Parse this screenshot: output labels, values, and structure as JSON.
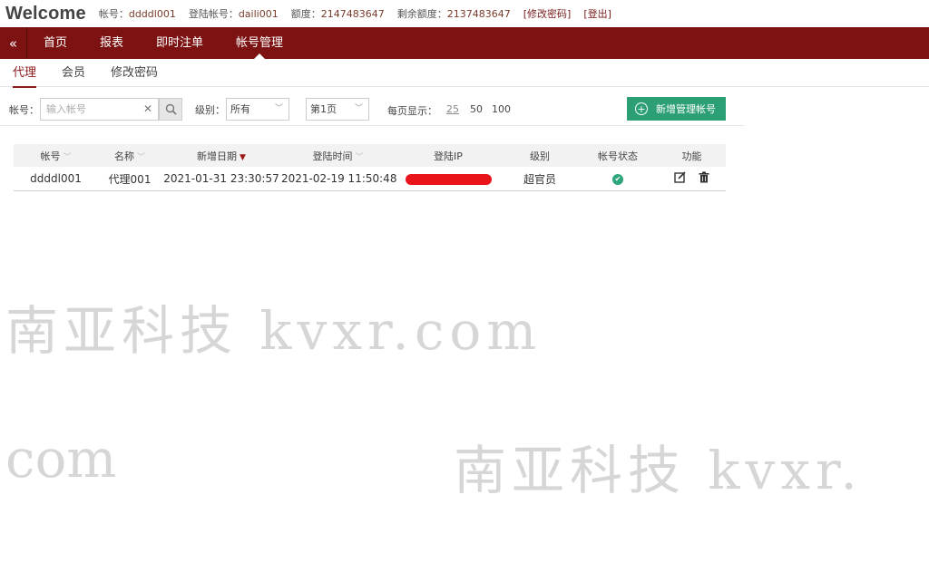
{
  "header": {
    "welcome": "Welcome",
    "account_label": "帐号：",
    "account_value": "ddddl001",
    "login_label": "登陆帐号：",
    "login_value": "daili001",
    "quota_label": "额度：",
    "quota_value": "2147483647",
    "remaining_label": "剩余额度：",
    "remaining_value": "2137483647",
    "change_password_link": "[修改密码]",
    "logout_link": "[登出]"
  },
  "nav": {
    "collapse_glyph": "«",
    "items": [
      {
        "label": "首页"
      },
      {
        "label": "报表"
      },
      {
        "label": "即时注单"
      },
      {
        "label": "帐号管理",
        "active": true
      }
    ]
  },
  "subtabs": [
    {
      "label": "代理",
      "active": true
    },
    {
      "label": "会员"
    },
    {
      "label": "修改密码"
    }
  ],
  "filters": {
    "account_label": "帐号：",
    "account_placeholder": "输入帐号",
    "clear_glyph": "✕",
    "level_label": "级别：",
    "level_value": "所有",
    "page_value": "第1页",
    "per_page_label": "每页显示：",
    "per_page_options": [
      "25",
      "50",
      "100"
    ],
    "per_page_selected": "25",
    "add_button_label": "新增管理帐号"
  },
  "table": {
    "columns": [
      "帐号",
      "名称",
      "新增日期",
      "登陆时间",
      "登陆IP",
      "级别",
      "帐号状态",
      "功能"
    ],
    "rows": [
      {
        "account": "ddddl001",
        "name": "代理001",
        "created": "2021-01-31 23:30:57",
        "last_login": "2021-02-19 11:50:48",
        "ip": "",
        "level": "超官员",
        "status": "active"
      }
    ]
  },
  "watermark": {
    "line1": "南亚科技 kvxr.com",
    "line2": "com",
    "line3": "南亚科技 kvxr."
  },
  "colors": {
    "nav_bg": "#7c1212",
    "add_button": "#2ca074",
    "status_ok": "#2ea57a",
    "redaction": "#e8141a"
  },
  "icons": {
    "search": "search-icon",
    "edit": "edit-icon",
    "delete": "trash-icon",
    "status": "check-circle-icon"
  }
}
